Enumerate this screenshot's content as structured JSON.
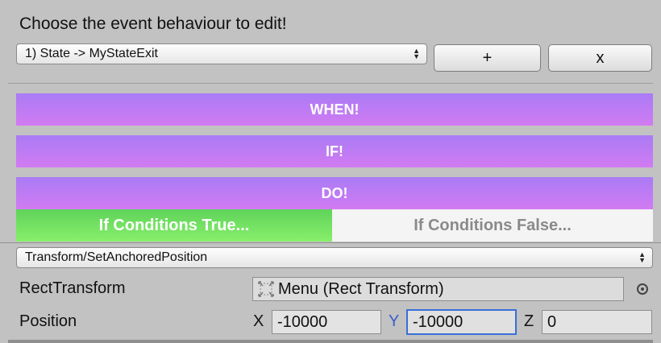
{
  "header": {
    "title": "Choose the event behaviour to edit!",
    "behaviour_select": "1) State -> MyStateExit",
    "add_label": "+",
    "remove_label": "x"
  },
  "sections": {
    "when": "WHEN!",
    "if": "IF!",
    "do": "DO!"
  },
  "tabs": {
    "true_label": "If Conditions True...",
    "false_label": "If Conditions False...",
    "active": "true"
  },
  "action": {
    "select": "Transform/SetAnchoredPosition",
    "rect_transform_label": "RectTransform",
    "rect_transform_value": "Menu (Rect Transform)",
    "position_label": "Position",
    "x_label": "X",
    "x_value": "-10000",
    "y_label": "Y",
    "y_value": "-10000",
    "z_label": "Z",
    "z_value": "0"
  },
  "colors": {
    "section_gradient": [
      "#a97bf5",
      "#d27bf2"
    ],
    "true_tab": "#6fe060",
    "focus": "#3a6fd8"
  }
}
